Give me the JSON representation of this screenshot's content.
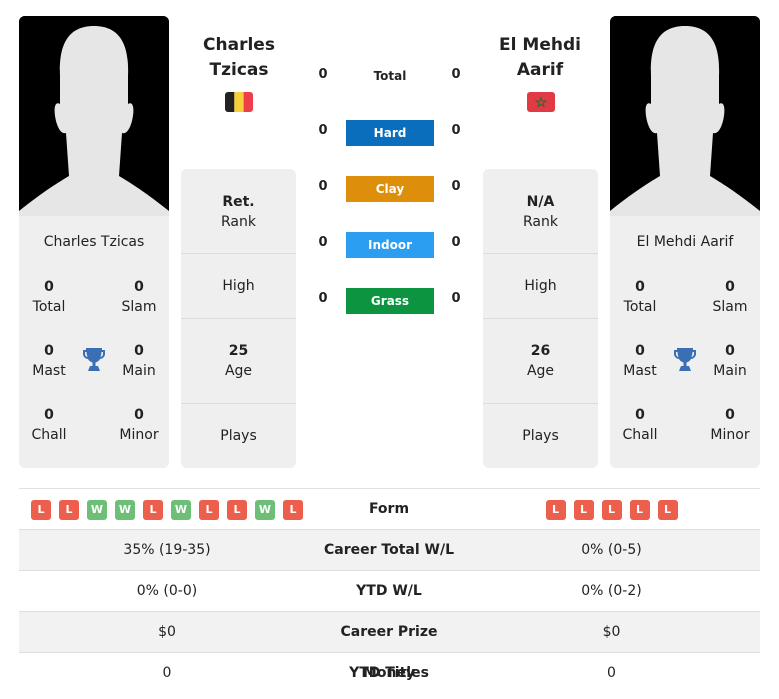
{
  "player1": {
    "name": "Charles Tzicas",
    "name_line1": "Charles",
    "name_line2": "Tzicas",
    "flag": "belgium-flag",
    "stats": {
      "total": {
        "value": "0",
        "label": "Total"
      },
      "slam": {
        "value": "0",
        "label": "Slam"
      },
      "mast": {
        "value": "0",
        "label": "Mast"
      },
      "main": {
        "value": "0",
        "label": "Main"
      },
      "chall": {
        "value": "0",
        "label": "Chall"
      },
      "minor": {
        "value": "0",
        "label": "Minor"
      }
    },
    "info": {
      "rank_value": "Ret.",
      "rank_label": "Rank",
      "high_label": "High",
      "age_value": "25",
      "age_label": "Age",
      "plays_label": "Plays"
    }
  },
  "player2": {
    "name": "El Mehdi Aarif",
    "name_line1": "El Mehdi",
    "name_line2": "Aarif",
    "flag": "morocco-flag",
    "stats": {
      "total": {
        "value": "0",
        "label": "Total"
      },
      "slam": {
        "value": "0",
        "label": "Slam"
      },
      "mast": {
        "value": "0",
        "label": "Mast"
      },
      "main": {
        "value": "0",
        "label": "Main"
      },
      "chall": {
        "value": "0",
        "label": "Chall"
      },
      "minor": {
        "value": "0",
        "label": "Minor"
      }
    },
    "info": {
      "rank_value": "N/A",
      "rank_label": "Rank",
      "high_label": "High",
      "age_value": "26",
      "age_label": "Age",
      "plays_label": "Plays"
    }
  },
  "h2h": {
    "total": {
      "label": "Total",
      "p1": "0",
      "p2": "0"
    },
    "surfaces": [
      {
        "label": "Hard",
        "p1": "0",
        "p2": "0",
        "color": "#0a6ebd"
      },
      {
        "label": "Clay",
        "p1": "0",
        "p2": "0",
        "color": "#dd8e0a"
      },
      {
        "label": "Indoor",
        "p1": "0",
        "p2": "0",
        "color": "#2b9ef2"
      },
      {
        "label": "Grass",
        "p1": "0",
        "p2": "0",
        "color": "#0d9440"
      }
    ]
  },
  "comparison": {
    "form": {
      "label": "Form",
      "p1": [
        "L",
        "L",
        "W",
        "W",
        "L",
        "W",
        "L",
        "L",
        "W",
        "L"
      ],
      "p2": [
        "L",
        "L",
        "L",
        "L",
        "L"
      ]
    },
    "rows": [
      {
        "label": "Career Total W/L",
        "p1": "35% (19-35)",
        "p2": "0% (0-5)"
      },
      {
        "label": "YTD W/L",
        "p1": "0% (0-0)",
        "p2": "0% (0-2)"
      },
      {
        "label": "Career Prize Money",
        "p1": "$0",
        "p2": "$0"
      },
      {
        "label": "YTD Titles",
        "p1": "0",
        "p2": "0"
      }
    ]
  },
  "colors": {
    "loss": "#ec5f4c",
    "win": "#6dbf78",
    "trophy": "#3a6fb5"
  }
}
